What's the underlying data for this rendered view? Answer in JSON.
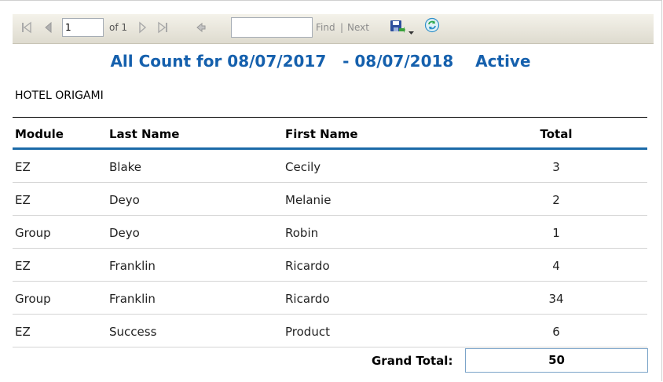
{
  "toolbar": {
    "page_value": "1",
    "of_label": "of 1",
    "find_label": "Find",
    "separator": "|",
    "next_label": "Next",
    "icons": [
      "first-page-icon",
      "previous-page-icon",
      "next-page-icon",
      "last-page-icon",
      "back-icon",
      "save-icon",
      "dropdown-arrow-icon",
      "refresh-icon"
    ]
  },
  "report": {
    "title": "All Count for 08/07/2017   - 08/07/2018    Active",
    "hotel": "HOTEL ORIGAMI",
    "columns": [
      "Module",
      "Last Name",
      "First Name",
      "Total"
    ],
    "rows": [
      [
        "EZ",
        "Blake",
        "Cecily",
        "3"
      ],
      [
        "EZ",
        "Deyo",
        "Melanie",
        "2"
      ],
      [
        "Group",
        "Deyo",
        "Robin",
        "1"
      ],
      [
        "EZ",
        "Franklin",
        "Ricardo",
        "4"
      ],
      [
        "Group",
        "Franklin",
        "Ricardo",
        "34"
      ],
      [
        "EZ",
        "Success",
        "Product",
        "6"
      ]
    ],
    "grand_total_label": "Grand Total:",
    "grand_total_value": "50"
  },
  "colors": {
    "title": "#1560ad",
    "header_rule": "#1b6aa8",
    "toolbar_top": "#f4f2ea",
    "toolbar_bottom": "#dedbcf"
  }
}
